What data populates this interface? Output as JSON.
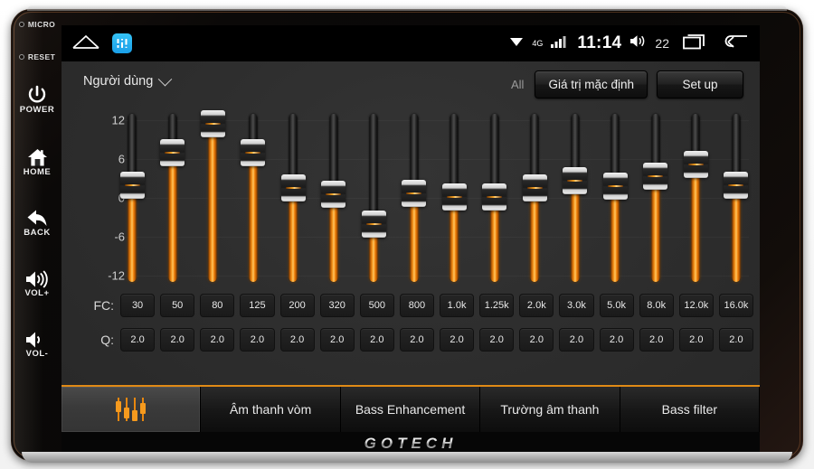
{
  "device": {
    "brand": "GOTECH",
    "rail": [
      {
        "type": "led",
        "label": "MICRO",
        "icon": "led-dot-icon"
      },
      {
        "type": "led",
        "label": "RESET",
        "icon": "led-dot-icon"
      },
      {
        "type": "button",
        "label": "POWER",
        "icon": "power-icon"
      },
      {
        "type": "button",
        "label": "HOME",
        "icon": "home-icon"
      },
      {
        "type": "button",
        "label": "BACK",
        "icon": "back-arrow-icon"
      },
      {
        "type": "button",
        "label": "VOL+",
        "icon": "volume-up-icon"
      },
      {
        "type": "button",
        "label": "VOL-",
        "icon": "volume-down-icon"
      }
    ]
  },
  "status_bar": {
    "home_icon": "home-outline-icon",
    "app_icon": "equalizer-app-icon",
    "wifi_icon": "wifi-icon",
    "network_label": "4G",
    "signal_icon": "signal-bars-icon",
    "time": "11:14",
    "volume_icon": "volume-icon",
    "volume_value": "22",
    "recents_icon": "recents-icon",
    "back_icon": "back-icon"
  },
  "header": {
    "preset_label": "Người dùng",
    "preset_chevron": "chevron-down-icon",
    "all_label": "All",
    "default_button": "Giá trị mặc định",
    "setup_button": "Set up"
  },
  "equalizer": {
    "scale_labels": [
      "12",
      "6",
      "0",
      "-6",
      "-12"
    ],
    "scale_min": -12,
    "scale_max": 12,
    "fc_row_label": "FC:",
    "q_row_label": "Q:",
    "bands": [
      {
        "fc": "30",
        "q": "2.0",
        "gain": 2.0
      },
      {
        "fc": "50",
        "q": "2.0",
        "gain": 7.0
      },
      {
        "fc": "80",
        "q": "2.0",
        "gain": 11.5
      },
      {
        "fc": "125",
        "q": "2.0",
        "gain": 7.0
      },
      {
        "fc": "200",
        "q": "2.0",
        "gain": 1.5
      },
      {
        "fc": "320",
        "q": "2.0",
        "gain": 0.5
      },
      {
        "fc": "500",
        "q": "2.0",
        "gain": -4.0
      },
      {
        "fc": "800",
        "q": "2.0",
        "gain": 0.7
      },
      {
        "fc": "1.0k",
        "q": "2.0",
        "gain": 0.2
      },
      {
        "fc": "1.25k",
        "q": "2.0",
        "gain": 0.2
      },
      {
        "fc": "2.0k",
        "q": "2.0",
        "gain": 1.6
      },
      {
        "fc": "3.0k",
        "q": "2.0",
        "gain": 2.6
      },
      {
        "fc": "5.0k",
        "q": "2.0",
        "gain": 1.8
      },
      {
        "fc": "8.0k",
        "q": "2.0",
        "gain": 3.4
      },
      {
        "fc": "12.0k",
        "q": "2.0",
        "gain": 5.2
      },
      {
        "fc": "16.0k",
        "q": "2.0",
        "gain": 1.9
      }
    ]
  },
  "tabs": [
    {
      "label": "",
      "icon": "equalizer-icon",
      "active": true
    },
    {
      "label": "Âm thanh vòm",
      "icon": "",
      "active": false
    },
    {
      "label": "Bass Enhancement",
      "icon": "",
      "active": false
    },
    {
      "label": "Trường âm thanh",
      "icon": "",
      "active": false
    },
    {
      "label": "Bass filter",
      "icon": "",
      "active": false
    }
  ],
  "colors": {
    "accent": "#e08a16",
    "slider_fill": "#f08a12",
    "screen_bg": "#2d2d2d",
    "status_bar_bg": "#000000"
  }
}
